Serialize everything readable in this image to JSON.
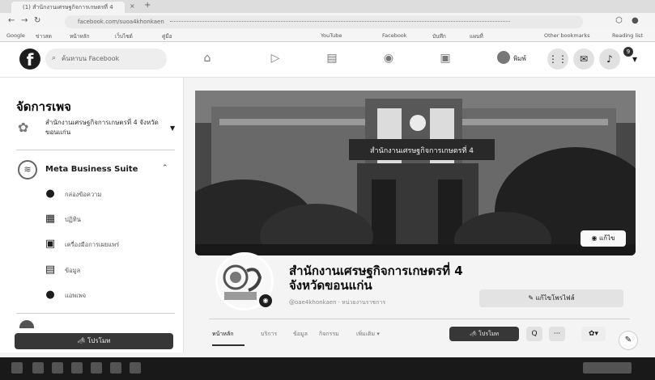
{
  "browser": {
    "tab_title": "(1) สำนักงานเศรษฐกิจการเกษตรที่ 4",
    "url": "facebook.com/suoa4khonkaen",
    "bookmarks": [
      "Google",
      "ข่าวสด",
      "หน้าหลัก",
      "เว็บไซต์",
      "คู่มือ",
      "YouTube",
      "Facebook",
      "บันทึก",
      "แผนที่",
      "Other bookmarks",
      "Reading list"
    ]
  },
  "fb_header": {
    "search_placeholder": "ค้นหาบน Facebook",
    "user_name": "พิมพ์",
    "notification_count": "9"
  },
  "sidebar": {
    "title": "จัดการเพจ",
    "page_name": "สำนักงานเศรษฐกิจการเกษตรที่ 4 จังหวัดขอนแก่น",
    "meta_suite_label": "Meta Business Suite",
    "items": [
      {
        "label": "กล่องข้อความ",
        "icon": "chat-icon"
      },
      {
        "label": "ปฏิทิน",
        "icon": "calendar-icon"
      },
      {
        "label": "เครื่องมือการเผยแพร่",
        "icon": "tools-icon"
      },
      {
        "label": "ข้อมูล",
        "icon": "insights-icon"
      },
      {
        "label": "แอพเพจ",
        "icon": "apps-icon"
      }
    ],
    "promote_label": "โปรโมท"
  },
  "page": {
    "cover_building_sign": "สำนักงานเศรษฐกิจการเกษตรที่ 4",
    "edit_cover_label": "แก้ไข",
    "name": "สำนักงานเศรษฐกิจการเกษตรที่ 4 จังหวัดขอนแก่น",
    "subtitle": "@oae4khonkaen · หน่วยงานราชการ",
    "edit_details_label": "แก้ไขโพรไฟล์",
    "tabs": [
      "หน้าหลัก",
      "บริการ",
      "ข้อมูล",
      "กิจกรรม",
      "เพิ่มเติม ▾"
    ],
    "promote_label": "โปรโมท",
    "search_symbol": "Q",
    "more_symbol": "···",
    "edit_symbol": "✎"
  },
  "colors": {
    "fb_dark": "#222222",
    "background": "#f4f4f4",
    "taskbar": "#1e1e1e"
  }
}
